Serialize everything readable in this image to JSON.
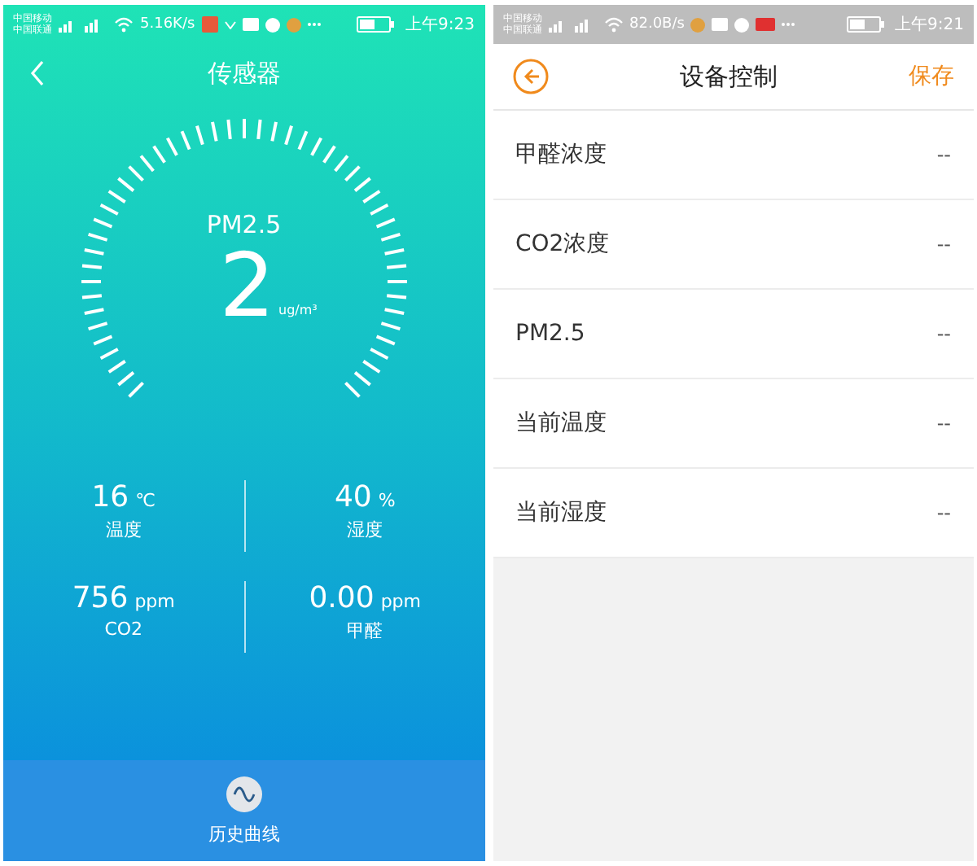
{
  "sensor_screen": {
    "status_bar": {
      "carriers": [
        "中国移动",
        "中国联通"
      ],
      "speed": "5.16K/s",
      "time": "上午9:23"
    },
    "title": "传感器",
    "gauge": {
      "label": "PM2.5",
      "value": "2",
      "unit": "ug/m³"
    },
    "readings": [
      {
        "value": "16",
        "unit": "℃",
        "label": "温度"
      },
      {
        "value": "40",
        "unit": "%",
        "label": "湿度"
      },
      {
        "value": "756",
        "unit": "ppm",
        "label": "CO2"
      },
      {
        "value": "0.00",
        "unit": "ppm",
        "label": "甲醛"
      }
    ],
    "history_button": {
      "label": "历史曲线"
    }
  },
  "control_screen": {
    "status_bar": {
      "carriers": [
        "中国移动",
        "中国联通"
      ],
      "speed": "82.0B/s",
      "time": "上午9:21"
    },
    "title": "设备控制",
    "save_button": "保存",
    "rows": [
      {
        "label": "甲醛浓度",
        "value": "--"
      },
      {
        "label": "CO2浓度",
        "value": "--"
      },
      {
        "label": "PM2.5",
        "value": "--"
      },
      {
        "label": "当前温度",
        "value": "--"
      },
      {
        "label": "当前湿度",
        "value": "--"
      }
    ]
  }
}
